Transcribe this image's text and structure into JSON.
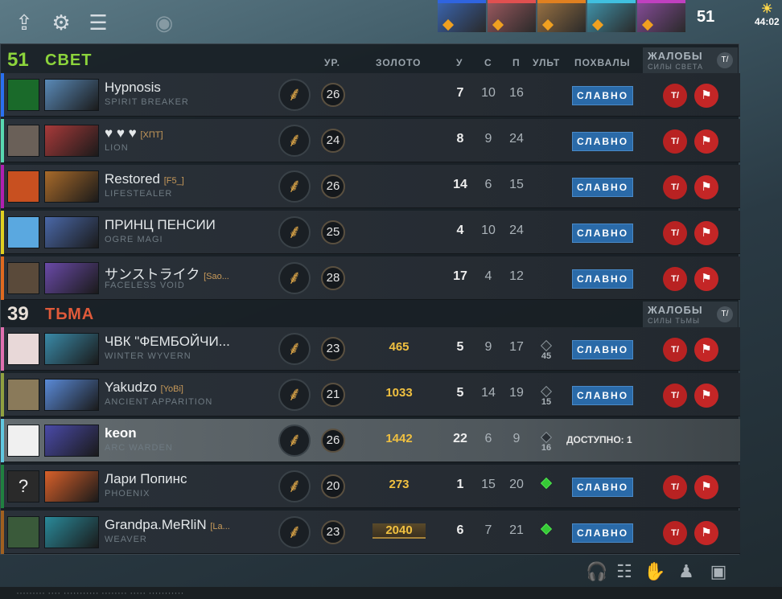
{
  "hud": {
    "icons": [
      "upload-icon",
      "gear-icon",
      "menu-icon",
      "eye-icon"
    ],
    "hero_strip_colors": [
      "#2f64e0",
      "#e05050",
      "#e08020",
      "#40c0e0",
      "#c040c0"
    ],
    "kills": "51",
    "clock": "44:02"
  },
  "teams": [
    {
      "score": "51",
      "name": "СВЕТ",
      "color": "#8cd43c",
      "reports_label": "ЖАЛОБЫ",
      "reports_sub": "СИЛЫ СВЕТА",
      "headers": {
        "level": "УР.",
        "gold": "ЗОЛОТО",
        "kills": "У",
        "deaths": "С",
        "assists": "П",
        "ult": "УЛЬТ",
        "praise": "ПОХВАЛЫ"
      },
      "players": [
        {
          "bar": "#2a70f0",
          "av": "#1a6a2a",
          "hero_color": "#5a8ab8",
          "name": "Hypnosis",
          "tag": "",
          "hero": "SPIRIT BREAKER",
          "level": "26",
          "gold": "",
          "k": "7",
          "d": "10",
          "a": "16",
          "ult": "",
          "praise": "СЛАВНО"
        },
        {
          "bar": "#58d8b0",
          "av": "#6a6058",
          "hero_color": "#a83a3a",
          "name": "♥ ♥ ♥",
          "tag": "[ХПТ]",
          "hero": "LION",
          "level": "24",
          "gold": "",
          "k": "8",
          "d": "9",
          "a": "24",
          "ult": "",
          "praise": "СЛАВНО"
        },
        {
          "bar": "#b020b0",
          "av": "#c85020",
          "hero_color": "#a86a2a",
          "name": "Restored",
          "tag": "[F5_]",
          "hero": "LIFESTEALER",
          "level": "26",
          "gold": "",
          "k": "14",
          "d": "6",
          "a": "15",
          "ult": "",
          "praise": "СЛАВНО"
        },
        {
          "bar": "#e0d020",
          "av": "#5aa8e0",
          "hero_color": "#4a68a8",
          "name": "ПРИНЦ ПЕНСИИ",
          "tag": "",
          "hero": "OGRE MAGI",
          "level": "25",
          "gold": "",
          "k": "4",
          "d": "10",
          "a": "24",
          "ult": "",
          "praise": "СЛАВНО"
        },
        {
          "bar": "#e06a20",
          "av": "#5a4a3a",
          "hero_color": "#6a4aa8",
          "name": "サンストライク",
          "tag": "[Sao...",
          "hero": "FACELESS VOID",
          "level": "28",
          "gold": "",
          "k": "17",
          "d": "4",
          "a": "12",
          "ult": "",
          "praise": "СЛАВНО"
        }
      ]
    },
    {
      "score": "39",
      "name": "ТЬМА",
      "color": "#e05a3a",
      "reports_label": "ЖАЛОБЫ",
      "reports_sub": "СИЛЫ ТЬМЫ",
      "players": [
        {
          "bar": "#e070b0",
          "av": "#e8d8d8",
          "hero_color": "#3a8aa8",
          "name": "ЧВК \"ФЕМБОЙЧИ...",
          "tag": "",
          "hero": "WINTER WYVERN",
          "level": "23",
          "gold": "465",
          "k": "5",
          "d": "9",
          "a": "17",
          "ult": "45",
          "ult_ready": false,
          "praise": "СЛАВНО"
        },
        {
          "bar": "#90a040",
          "av": "#8a7a5a",
          "hero_color": "#5a8ad8",
          "name": "Yakudzo",
          "tag": "[YoBi]",
          "hero": "ANCIENT APPARITION",
          "level": "21",
          "gold": "1033",
          "k": "5",
          "d": "14",
          "a": "19",
          "ult": "15",
          "ult_ready": false,
          "praise": "СЛАВНО"
        },
        {
          "bar": "#60c8e0",
          "av": "#f0f0f0",
          "hero_color": "#4a4aa8",
          "name": "keon",
          "tag": "",
          "hero": "ARC WARDEN",
          "level": "26",
          "gold": "1442",
          "k": "22",
          "d": "6",
          "a": "9",
          "ult": "16",
          "ult_ready": false,
          "available": "ДОСТУПНО: 1",
          "me": true
        },
        {
          "bar": "#208040",
          "av": "#2a2a2a",
          "hero_color": "#d8602a",
          "name": "Лари Попинс",
          "tag": "",
          "hero": "PHOENIX",
          "level": "20",
          "gold": "273",
          "k": "1",
          "d": "15",
          "a": "20",
          "ult": "",
          "ult_ready": true,
          "praise": "СЛАВНО",
          "av_text": "?"
        },
        {
          "bar": "#a06020",
          "av": "#3a5a3a",
          "hero_color": "#2a8a9a",
          "name": "Grandpa.MeRliN",
          "tag": "[La...",
          "hero": "WEAVER",
          "level": "23",
          "gold": "2040",
          "gold_hi": true,
          "k": "6",
          "d": "7",
          "a": "21",
          "ult": "",
          "ult_ready": true,
          "praise": "СЛАВНО"
        }
      ]
    }
  ],
  "footer_icons": [
    "headset-icon",
    "scoreboard-icon",
    "hand-icon",
    "coach-icon",
    "chest-icon"
  ],
  "bottom_bar_text": "·········  ····  ···········   ········   ·····  ···········"
}
